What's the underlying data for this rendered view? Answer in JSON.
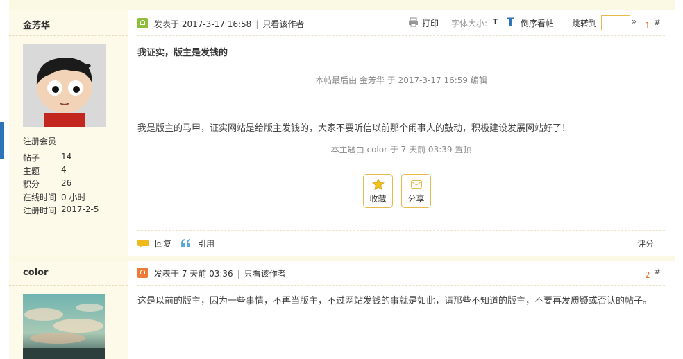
{
  "posts": [
    {
      "author": {
        "name": "金芳华",
        "role": "注册会员",
        "stats": [
          {
            "label": "帖子",
            "value": "14"
          },
          {
            "label": "主题",
            "value": "4"
          },
          {
            "label": "积分",
            "value": "26"
          },
          {
            "label": "在线时间",
            "value": "0 小时"
          },
          {
            "label": "注册时间",
            "value": "2017-2-5"
          }
        ]
      },
      "posted": "发表于 2017-3-17 16:58",
      "only_author": "只看该作者",
      "toolbar": {
        "print": "打印",
        "font_size": "字体大小:",
        "font_size_t": "T",
        "reverse_t": "T",
        "reverse": "倒序看帖",
        "jump": "跳转到",
        "jump_arrow": "»"
      },
      "floor": "1",
      "hash": "#",
      "title": "我证实，版主是发钱的",
      "edit_note": "本帖最后由 金芳华 于 2017-3-17 16:59 编辑",
      "body": "我是版主的马甲，证实网站是给版主发钱的，大家不要听信以前那个闹事人的鼓动，积极建设发展网站好了！",
      "sticky_note": "本主题由 color 于 7 天前 03:39 置顶",
      "actions": {
        "favorite": "收藏",
        "share": "分享"
      },
      "bottom": {
        "reply": "回复",
        "quote": "引用",
        "rate": "评分"
      }
    },
    {
      "author": {
        "name": "color"
      },
      "posted": "发表于 7 天前 03:36",
      "only_author": "只看该作者",
      "floor": "2",
      "hash": "#",
      "body": "这是以前的版主，因为一些事情，不再当版主，不过网站发钱的事就是如此，请那些不知道的版主，不要再发质疑或否认的帖子。"
    }
  ],
  "colors": {
    "accent": "#e2702a",
    "sidebar_bg": "#fdfaea",
    "border": "#e8b94b",
    "link_blue": "#2c73b7"
  }
}
